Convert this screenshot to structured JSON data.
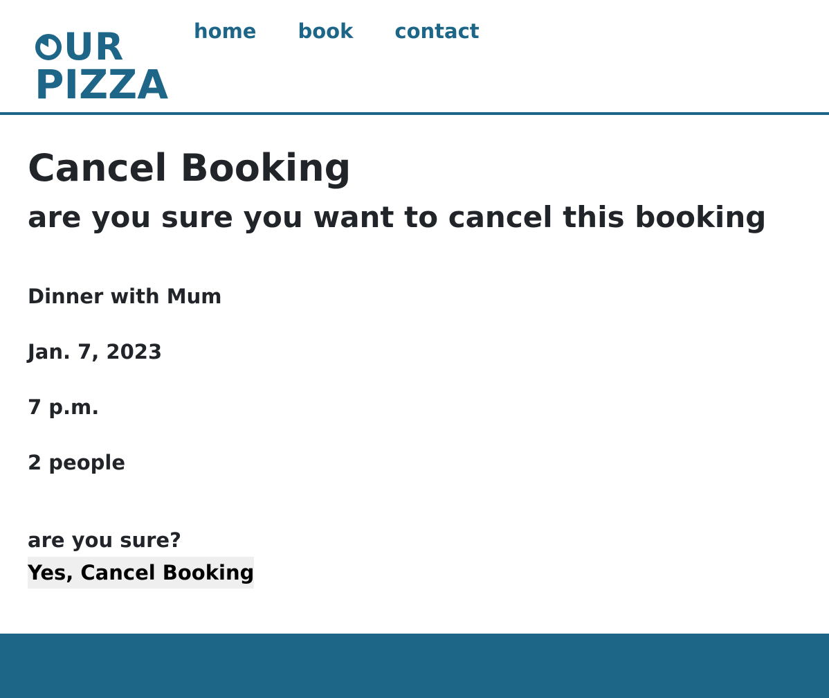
{
  "brand": {
    "line1": "UR",
    "line2": "PIZZA",
    "color": "#1d6688"
  },
  "nav": {
    "home": "home",
    "book": "book",
    "contact": "contact"
  },
  "page": {
    "title": "Cancel Booking",
    "subtitle": "are you sure you want to cancel this booking"
  },
  "booking": {
    "name": "Dinner with Mum",
    "date": "Jan. 7, 2023",
    "time": "7 p.m.",
    "guests": "2 people"
  },
  "confirm": {
    "label": "are you sure?",
    "button": "Yes, Cancel Booking"
  },
  "icons": {
    "logo_ring": "ring-icon"
  }
}
